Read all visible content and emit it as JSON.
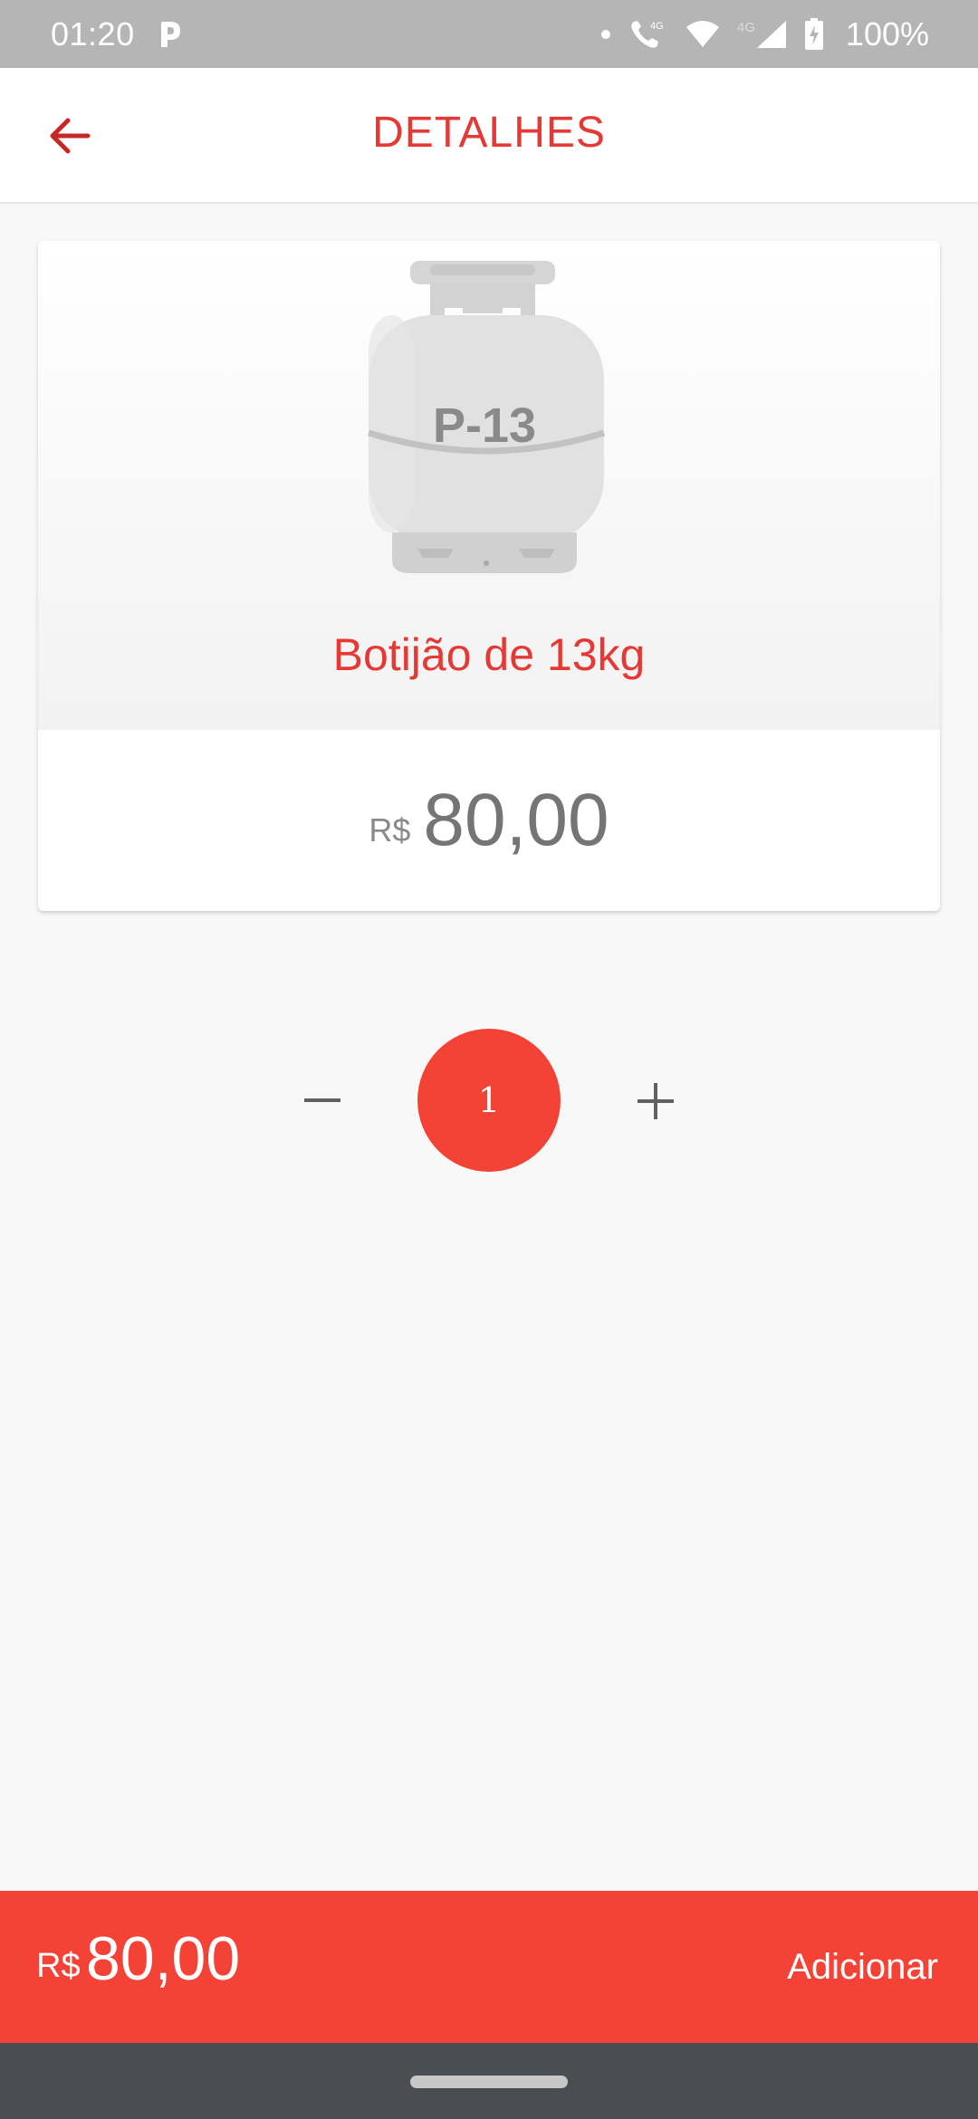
{
  "status_bar": {
    "time": "01:20",
    "network_1": "4G",
    "network_2": "4G",
    "battery": "100%",
    "icons": [
      "parking-icon",
      "dot-icon",
      "call-icon",
      "wifi-icon",
      "signal-icon",
      "battery-charging-icon"
    ]
  },
  "header": {
    "title": "DETALHES",
    "back_icon": "arrow-left-icon"
  },
  "colors": {
    "accent": "#f44336",
    "title_red": "#e53935",
    "price_gray": "#757575",
    "status_bar": "#b5b5b5",
    "nav_bar": "#4a4d52"
  },
  "product": {
    "image_label": "P-13",
    "name": "Botijão de 13kg",
    "currency": "R$",
    "price": "80,00"
  },
  "stepper": {
    "quantity": "1",
    "decrement_icon": "minus-icon",
    "increment_icon": "plus-icon"
  },
  "footer": {
    "currency": "R$",
    "total": "80,00",
    "add_label": "Adicionar"
  }
}
